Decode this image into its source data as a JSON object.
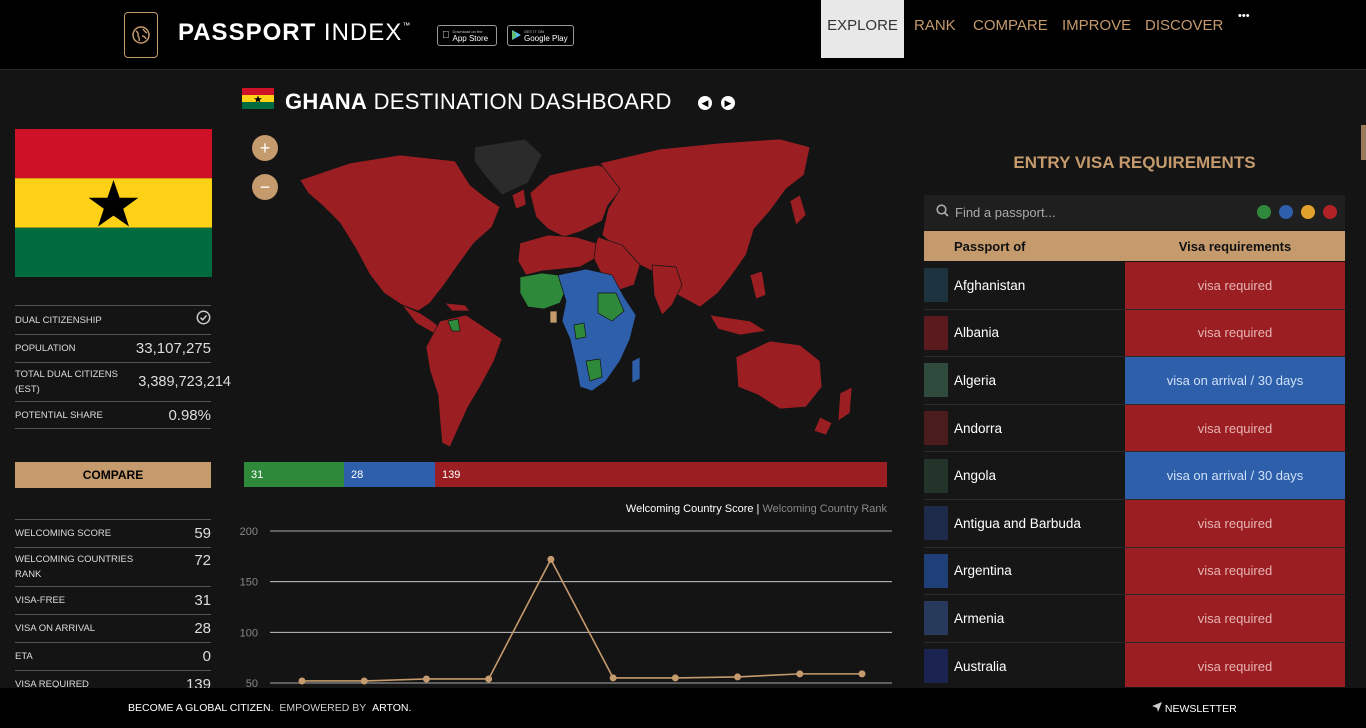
{
  "header": {
    "brand_bold": "PASSPORT",
    "brand_light": "INDEX",
    "trademark": "™",
    "app_store_small": "Download on the",
    "app_store_big": "App Store",
    "google_play_small": "GET IT ON",
    "google_play_big": "Google Play",
    "nav": [
      "EXPLORE",
      "RANK",
      "COMPARE",
      "IMPROVE",
      "DISCOVER"
    ],
    "more": "•••",
    "colors": {
      "accent": "#c59a6d",
      "active_bg": "#e8e8e8"
    }
  },
  "left": {
    "stats_top": [
      {
        "label": "DUAL CITIZENSHIP",
        "value": "",
        "icon": "check-circle-icon"
      },
      {
        "label": "POPULATION",
        "value": "33,107,275"
      },
      {
        "label": "TOTAL DUAL CITIZENS (EST)",
        "value": "3,389,723,214"
      },
      {
        "label": "POTENTIAL SHARE",
        "value": "0.98%"
      }
    ],
    "compare_label": "COMPARE",
    "stats_bottom": [
      {
        "label": "WELCOMING SCORE",
        "value": "59"
      },
      {
        "label": "WELCOMING COUNTRIES RANK",
        "value": "72"
      },
      {
        "label": "VISA-FREE",
        "value": "31"
      },
      {
        "label": "VISA ON ARRIVAL",
        "value": "28"
      },
      {
        "label": "ETA",
        "value": "0"
      },
      {
        "label": "VISA REQUIRED",
        "value": "139"
      }
    ]
  },
  "center": {
    "title_bold": "GHANA",
    "title_rest": "DESTINATION DASHBOARD",
    "prev_icon": "chevron-left-icon",
    "next_icon": "chevron-right-icon",
    "zoom_in": "+",
    "zoom_out": "−",
    "bars": [
      {
        "value": "31",
        "color": "#2e8a3a"
      },
      {
        "value": "28",
        "color": "#2d5fab"
      },
      {
        "value": "139",
        "color": "#9b1f22"
      }
    ],
    "legend_active": "Welcoming Country Score",
    "legend_sep": " | ",
    "legend_inactive": "Welcoming Country Rank"
  },
  "chart_data": {
    "type": "line",
    "title": "",
    "series": [
      {
        "name": "Welcoming Country Score",
        "values": [
          52,
          52,
          54,
          54,
          172,
          55,
          55,
          56,
          59,
          59
        ]
      },
      {
        "name": "Welcoming Country Rank",
        "values": []
      }
    ],
    "y_ticks": [
      50,
      100,
      150,
      200
    ],
    "ylim": [
      50,
      200
    ],
    "grid": true,
    "legend": "top-right",
    "color": "#c59a6d"
  },
  "right": {
    "title": "ENTRY VISA REQUIREMENTS",
    "search_placeholder": "Find a passport...",
    "filter_colors": [
      "#2e8a3a",
      "#2d5fab",
      "#e0a22b",
      "#b02226"
    ],
    "col_passport": "Passport of",
    "col_visa": "Visa requirements",
    "rows": [
      {
        "country": "Afghanistan",
        "req": "visa required",
        "type": "red",
        "passport_color": "#1d3440"
      },
      {
        "country": "Albania",
        "req": "visa required",
        "type": "red",
        "passport_color": "#5a1a1e"
      },
      {
        "country": "Algeria",
        "req": "visa on arrival / 30 days",
        "type": "blue",
        "passport_color": "#2f4b3d"
      },
      {
        "country": "Andorra",
        "req": "visa required",
        "type": "red",
        "passport_color": "#4a1c1c"
      },
      {
        "country": "Angola",
        "req": "visa on arrival / 30 days",
        "type": "blue",
        "passport_color": "#23352b"
      },
      {
        "country": "Antigua and Barbuda",
        "req": "visa required",
        "type": "red",
        "passport_color": "#1d2a4a"
      },
      {
        "country": "Argentina",
        "req": "visa required",
        "type": "red",
        "passport_color": "#1f3f78"
      },
      {
        "country": "Armenia",
        "req": "visa required",
        "type": "red",
        "passport_color": "#283a5c"
      },
      {
        "country": "Australia",
        "req": "visa required",
        "type": "red",
        "passport_color": "#1b2350"
      }
    ]
  },
  "footer": {
    "slogan": "BECOME A GLOBAL CITIZEN.",
    "empowered": "EMPOWERED BY",
    "arton": "ARTON.",
    "newsletter": "NEWSLETTER"
  }
}
